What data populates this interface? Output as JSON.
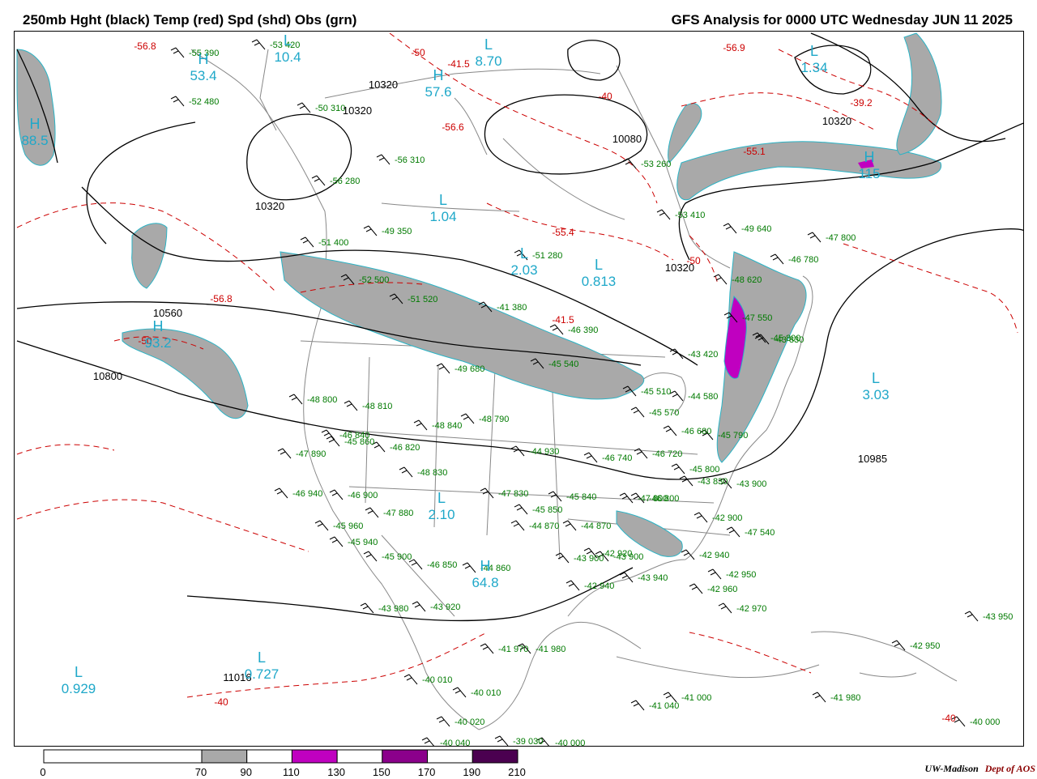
{
  "header": {
    "left_title": "250mb Hght (black) Temp (red) Spd (shd) Obs (grn)",
    "right_title": "GFS Analysis for 0000 UTC Wednesday  JUN 11 2025"
  },
  "colors": {
    "height_contour": "#000000",
    "temp_contour": "#cc0000",
    "obs": "#007a00",
    "pressure_centers": "#1fa8c9",
    "map_lines": "#888888",
    "speed_70_90": "#a9a9a9",
    "speed_110_130": "#c000c0",
    "speed_150_170": "#8b008b",
    "speed_190_210": "#4b0050"
  },
  "colorbar": {
    "ticks": [
      "0",
      "70",
      "90",
      "110",
      "130",
      "150",
      "170",
      "190",
      "210"
    ],
    "bins": [
      {
        "from": 0,
        "to": 70,
        "color": "#ffffff"
      },
      {
        "from": 70,
        "to": 90,
        "color": "#a9a9a9"
      },
      {
        "from": 90,
        "to": 110,
        "color": "#ffffff"
      },
      {
        "from": 110,
        "to": 130,
        "color": "#c000c0"
      },
      {
        "from": 130,
        "to": 150,
        "color": "#ffffff"
      },
      {
        "from": 150,
        "to": 170,
        "color": "#8b008b"
      },
      {
        "from": 170,
        "to": 190,
        "color": "#ffffff"
      },
      {
        "from": 190,
        "to": 210,
        "color": "#4b0050"
      }
    ]
  },
  "height_labels": [
    "10320",
    "10320",
    "10320",
    "10320",
    "10080",
    "10560",
    "10800",
    "10985",
    "11016",
    "10320"
  ],
  "temp_labels": [
    "-56.8",
    "-50",
    "-41.5",
    "-40",
    "-56.6",
    "-56.8",
    "-55.4",
    "-50",
    "-41.5",
    "-50",
    "-55.1",
    "-40",
    "-39.2",
    "-56.9",
    "-40"
  ],
  "centers": [
    {
      "type": "H",
      "value": "88.5"
    },
    {
      "type": "H",
      "value": "53.4"
    },
    {
      "type": "L",
      "value": "10.4"
    },
    {
      "type": "L",
      "value": "8.70"
    },
    {
      "type": "H",
      "value": "57.6"
    },
    {
      "type": "L",
      "value": "1.04"
    },
    {
      "type": "L",
      "value": "2.03"
    },
    {
      "type": "L",
      "value": "0.813"
    },
    {
      "type": "H",
      "value": "93.2"
    },
    {
      "type": "L",
      "value": "3.03"
    },
    {
      "type": "L",
      "value": "2.10"
    },
    {
      "type": "H",
      "value": "64.8"
    },
    {
      "type": "L",
      "value": "0.929"
    },
    {
      "type": "L",
      "value": "0.727"
    },
    {
      "type": "L",
      "value": "1.34"
    },
    {
      "type": "H",
      "value": "115"
    }
  ],
  "observations": [
    "-53 420",
    "-55 390",
    "-52 480",
    "-50 310",
    "-56 310",
    "-56 280",
    "-49 350",
    "-51 400",
    "-52 500",
    "-51 520",
    "-51 280",
    "-53 260",
    "-53 410",
    "-49 640",
    "-47 800",
    "-46 780",
    "-48 620",
    "-47 550",
    "-43 830",
    "-43 420",
    "-41 380",
    "-46 390",
    "-45 540",
    "-49 680",
    "-48 810",
    "-48 800",
    "-47 890",
    "-45 860",
    "-48 840",
    "-48 790",
    "-46 820",
    "-48 830",
    "-46 940",
    "-46 900",
    "-47 880",
    "-45 960",
    "-45 940",
    "-45 900",
    "-46 850",
    "-44 860",
    "-43 900",
    "-43 980",
    "-43 920",
    "-43 940",
    "-41 970",
    "-41 980",
    "-47 830",
    "-45 850",
    "-44 870",
    "-45 840",
    "-44 870",
    "-43 900",
    "-42 920",
    "-42 940",
    "-44 930",
    "-46 800",
    "-46 740",
    "-46 720",
    "-46 680",
    "-45 790",
    "-45 800",
    "-43 830",
    "-43 900",
    "-42 900",
    "-42 940",
    "-42 950",
    "-42 960",
    "-42 970",
    "-43 950",
    "-42 950",
    "-41 980",
    "-41 040",
    "-41 000",
    "-40 010",
    "-40 020",
    "-40 040",
    "-39 030",
    "-40 000",
    "-40 000",
    "-45 570",
    "-44 580",
    "-45 510",
    "-45 800",
    "-47 540",
    "-40 010",
    "-46 840",
    "-47 800"
  ],
  "credit": {
    "org": "UW-Madison",
    "dept": "Dept of AOS"
  }
}
